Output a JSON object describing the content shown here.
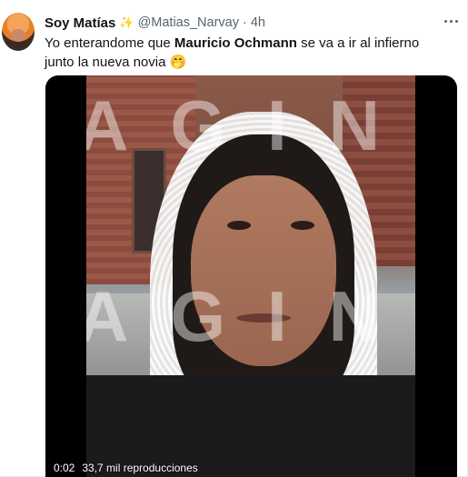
{
  "tweet": {
    "display_name": "Soy Matías",
    "name_emoji": "✨",
    "handle": "@Matias_Narvay",
    "separator": "·",
    "time": "4h",
    "text_before": "Yo enterandome que ",
    "text_bold": "Mauricio Ochmann",
    "text_after": " se va a ir al infierno junto la nueva novia ",
    "text_emoji": "🤭"
  },
  "video": {
    "watermark_top": "AGIN",
    "watermark_bottom": "AGIN",
    "timestamp": "0:02",
    "views": "33,7 mil reproducciones"
  },
  "icons": {
    "more": "more-options-icon",
    "avatar": "avatar"
  }
}
